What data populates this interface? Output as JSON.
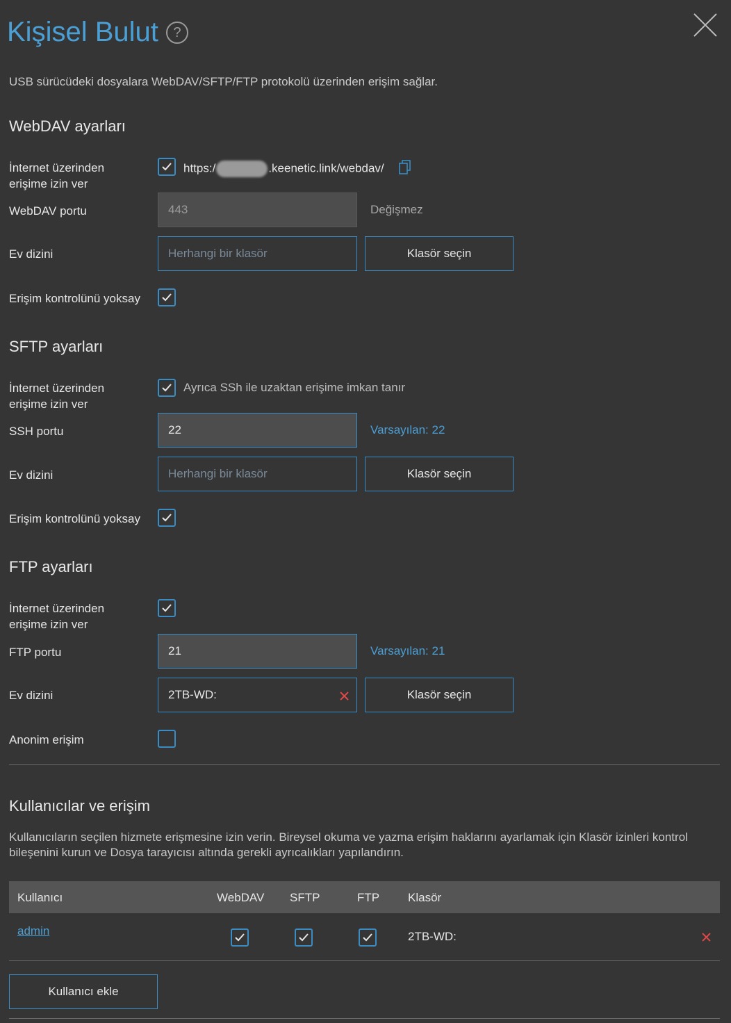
{
  "header": {
    "title": "Kişisel Bulut",
    "help_icon": "question-circle-icon",
    "close_icon": "close-icon"
  },
  "description": "USB sürücüdeki dosyalara WebDAV/SFTP/FTP protokolü üzerinden erişim sağlar.",
  "webdav": {
    "section_title": "WebDAV ayarları",
    "internet_access_label": "İnternet üzerinden erişime izin ver",
    "internet_access_checked": true,
    "url_prefix": "https:/",
    "url_suffix": ".keenetic.link/webdav/",
    "port_label": "WebDAV portu",
    "port_value": "443",
    "port_hint": "Değişmez",
    "home_label": "Ev dizini",
    "home_placeholder": "Herhangi bir klasör",
    "select_folder_label": "Klasör seçin",
    "ignore_acl_label": "Erişim kontrolünü yoksay",
    "ignore_acl_checked": true
  },
  "sftp": {
    "section_title": "SFTP ayarları",
    "internet_access_label": "İnternet üzerinden erişime izin ver",
    "internet_access_checked": true,
    "internet_access_note": "Ayrıca SSh ile uzaktan erişime imkan tanır",
    "port_label": "SSH portu",
    "port_value": "22",
    "port_hint": "Varsayılan: 22",
    "home_label": "Ev dizini",
    "home_placeholder": "Herhangi bir klasör",
    "select_folder_label": "Klasör seçin",
    "ignore_acl_label": "Erişim kontrolünü yoksay",
    "ignore_acl_checked": true
  },
  "ftp": {
    "section_title": "FTP ayarları",
    "internet_access_label": "İnternet üzerinden erişime izin ver",
    "internet_access_checked": true,
    "port_label": "FTP portu",
    "port_value": "21",
    "port_hint": "Varsayılan: 21",
    "home_label": "Ev dizini",
    "home_value": "2TB-WD:",
    "select_folder_label": "Klasör seçin",
    "anon_label": "Anonim erişim",
    "anon_checked": false
  },
  "users": {
    "section_title": "Kullanıcılar ve erişim",
    "description": "Kullanıcıların seçilen hizmete erişmesine izin verin. Bireysel okuma ve yazma erişim haklarını ayarlamak için Klasör izinleri kontrol bileşenini kurun ve Dosya tarayıcısı altında gerekli ayrıcalıkları yapılandırın.",
    "columns": [
      "Kullanıcı",
      "WebDAV",
      "SFTP",
      "FTP",
      "Klasör"
    ],
    "rows": [
      {
        "user": "admin",
        "webdav": true,
        "sftp": true,
        "ftp": true,
        "folder": "2TB-WD:"
      }
    ],
    "add_user_label": "Kullanıcı ekle"
  },
  "colors": {
    "background": "#353535",
    "accent": "#4a9fd5",
    "checkbox_border": "#3a8dc4",
    "delete": "#e04848"
  }
}
